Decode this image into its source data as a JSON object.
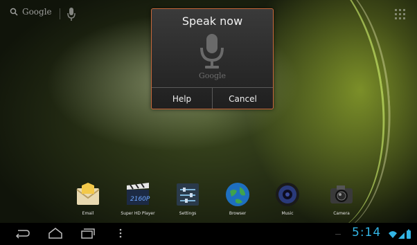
{
  "search": {
    "label": "Google"
  },
  "dialog": {
    "title": "Speak now",
    "brand": "Google",
    "help_label": "Help",
    "cancel_label": "Cancel"
  },
  "dock": {
    "items": [
      {
        "label": "Email",
        "icon": "email-icon"
      },
      {
        "label": "Super HD Player",
        "icon": "video-player-icon"
      },
      {
        "label": "Settings",
        "icon": "settings-icon"
      },
      {
        "label": "Browser",
        "icon": "browser-globe-icon"
      },
      {
        "label": "Music",
        "icon": "music-speaker-icon"
      },
      {
        "label": "Camera",
        "icon": "camera-icon"
      }
    ],
    "clapper_text": "2160P"
  },
  "status": {
    "time": "5:14"
  },
  "colors": {
    "dialog_border": "#c9683b",
    "clock": "#33b5e5"
  }
}
